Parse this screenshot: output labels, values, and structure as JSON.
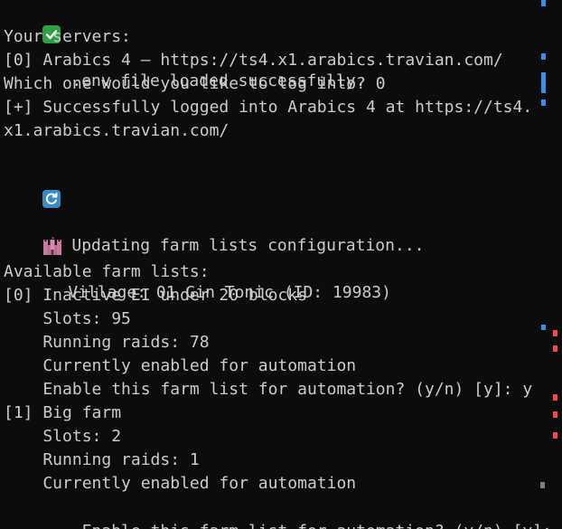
{
  "terminal": {
    "lines": {
      "env_loaded": ".env file loaded successfully.",
      "your_servers": "Your servers:",
      "server_0": "[0] Arabics 4 — https://ts4.x1.arabics.travian.com/",
      "which_one_prompt": "Which one would you like to log into? 0",
      "login_success_1": "[+] Successfully logged into Arabics 4 at https://ts4.",
      "login_success_2": "x1.arabics.travian.com/",
      "updating": "Updating farm lists configuration...",
      "village": "Village: 01 Gin Tonic (ID: 19983)",
      "available_lists": "Available farm lists:",
      "list0_title": "[0] Inactive EI under 20 blocks",
      "list0_slots": "    Slots: 95",
      "list0_raids": "    Running raids: 78",
      "list0_status": "    Currently enabled for automation",
      "list0_prompt": "    Enable this farm list for automation? (y/n) [y]: y",
      "list1_title": "[1] Big farm",
      "list1_slots": "    Slots: 2",
      "list1_raids": "    Running raids: 1",
      "list1_status": "    Currently enabled for automation",
      "list1_prompt": "    Enable this farm list for automation? (y/n) [y]: "
    },
    "icons": {
      "check": "check-icon",
      "refresh": "refresh-icon",
      "castle": "castle-icon"
    },
    "colors": {
      "background": "#0c0c0c",
      "text": "#cccccc",
      "check_green": "#2ea043",
      "refresh_blue": "#3a8ac4",
      "minimap_blue": "#3b8eea",
      "minimap_red": "#f14c4c",
      "minimap_gray": "#7f7f7f"
    }
  }
}
